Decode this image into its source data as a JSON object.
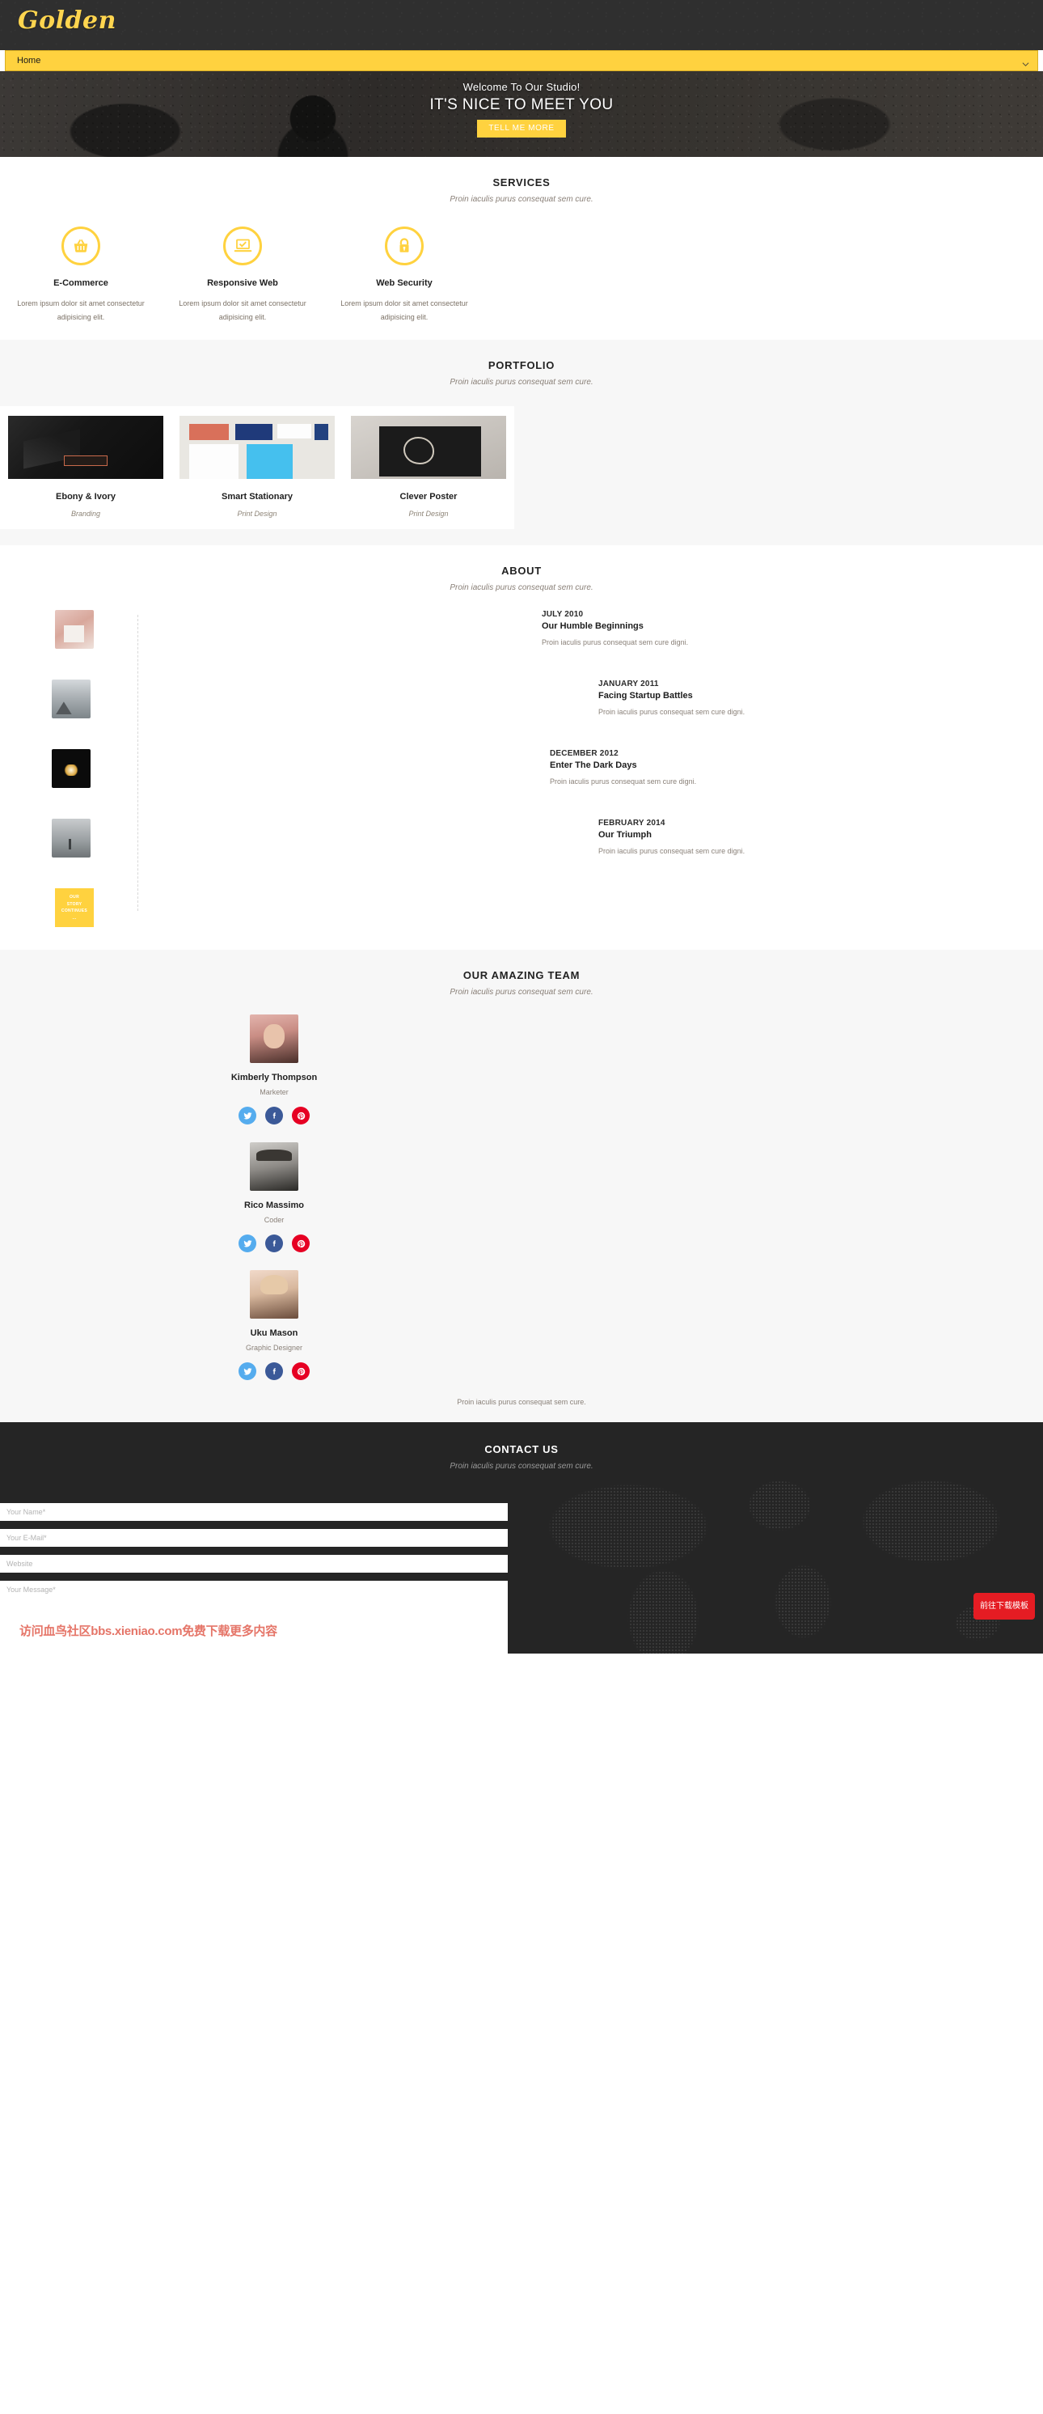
{
  "header": {
    "brand": "Golden",
    "nav": {
      "selected": "Home",
      "caret_icon": "chevron-down-icon",
      "options": [
        "Home"
      ]
    }
  },
  "hero": {
    "subtitle": "Welcome To Our Studio!",
    "title": "IT'S NICE TO MEET YOU",
    "cta_label": "TELL ME MORE"
  },
  "services": {
    "title": "SERVICES",
    "subtitle": "Proin iaculis purus consequat sem cure.",
    "items": [
      {
        "icon": "shopping-basket-icon",
        "name": "E-Commerce",
        "desc": "Lorem ipsum dolor sit amet consectetur adipisicing elit."
      },
      {
        "icon": "laptop-check-icon",
        "name": "Responsive Web",
        "desc": "Lorem ipsum dolor sit amet consectetur adipisicing elit."
      },
      {
        "icon": "lock-icon",
        "name": "Web Security",
        "desc": "Lorem ipsum dolor sit amet consectetur adipisicing elit."
      }
    ]
  },
  "portfolio": {
    "title": "PORTFOLIO",
    "subtitle": "Proin iaculis purus consequat sem cure.",
    "items": [
      {
        "name": "Ebony & Ivory",
        "category": "Branding"
      },
      {
        "name": "Smart Stationary",
        "category": "Print Design"
      },
      {
        "name": "Clever Poster",
        "category": "Print Design"
      }
    ]
  },
  "about": {
    "title": "ABOUT",
    "subtitle": "Proin iaculis purus consequat sem cure.",
    "timeline": [
      {
        "date": "JULY 2010",
        "heading": "Our Humble Beginnings",
        "body": "Proin iaculis purus consequat sem cure digni."
      },
      {
        "date": "JANUARY 2011",
        "heading": "Facing Startup Battles",
        "body": "Proin iaculis purus consequat sem cure digni."
      },
      {
        "date": "DECEMBER 2012",
        "heading": "Enter The Dark Days",
        "body": "Proin iaculis purus consequat sem cure digni."
      },
      {
        "date": "FEBRUARY 2014",
        "heading": "Our Triumph",
        "body": "Proin iaculis purus consequat sem cure digni."
      }
    ],
    "end_badge": {
      "line1": "OUR",
      "line2": "STORY",
      "line3": "CONTINUES",
      "line4": "..."
    }
  },
  "team": {
    "title": "OUR AMAZING TEAM",
    "subtitle": "Proin iaculis purus consequat sem cure.",
    "members": [
      {
        "name": "Kimberly Thompson",
        "role": "Marketer"
      },
      {
        "name": "Rico Massimo",
        "role": "Coder"
      },
      {
        "name": "Uku Mason",
        "role": "Graphic Designer"
      }
    ],
    "socials": [
      {
        "icon": "twitter-icon",
        "color": "#55acee"
      },
      {
        "icon": "facebook-icon",
        "color": "#3b5998"
      },
      {
        "icon": "pinterest-icon",
        "color": "#e60023"
      }
    ],
    "footnote": "Proin iaculis purus consequat sem cure."
  },
  "contact": {
    "title": "CONTACT US",
    "subtitle": "Proin iaculis purus consequat sem cure.",
    "fields": {
      "name_placeholder": "Your Name*",
      "name_value": "",
      "email_placeholder": "Your E-Mail*",
      "email_value": "",
      "website_placeholder": "Website",
      "website_value": "",
      "message_placeholder": "Your Message*",
      "message_value": ""
    }
  },
  "overlay": {
    "watermark": "访问血鸟社区bbs.xieniao.com免费下载更多内容",
    "download_button": "前往下载模板"
  },
  "colors": {
    "accent": "#ffd23f",
    "dark": "#2f2f2f",
    "contact_bg": "#252525",
    "watermark": "#e36a5c",
    "download_btn": "#e51c23"
  }
}
